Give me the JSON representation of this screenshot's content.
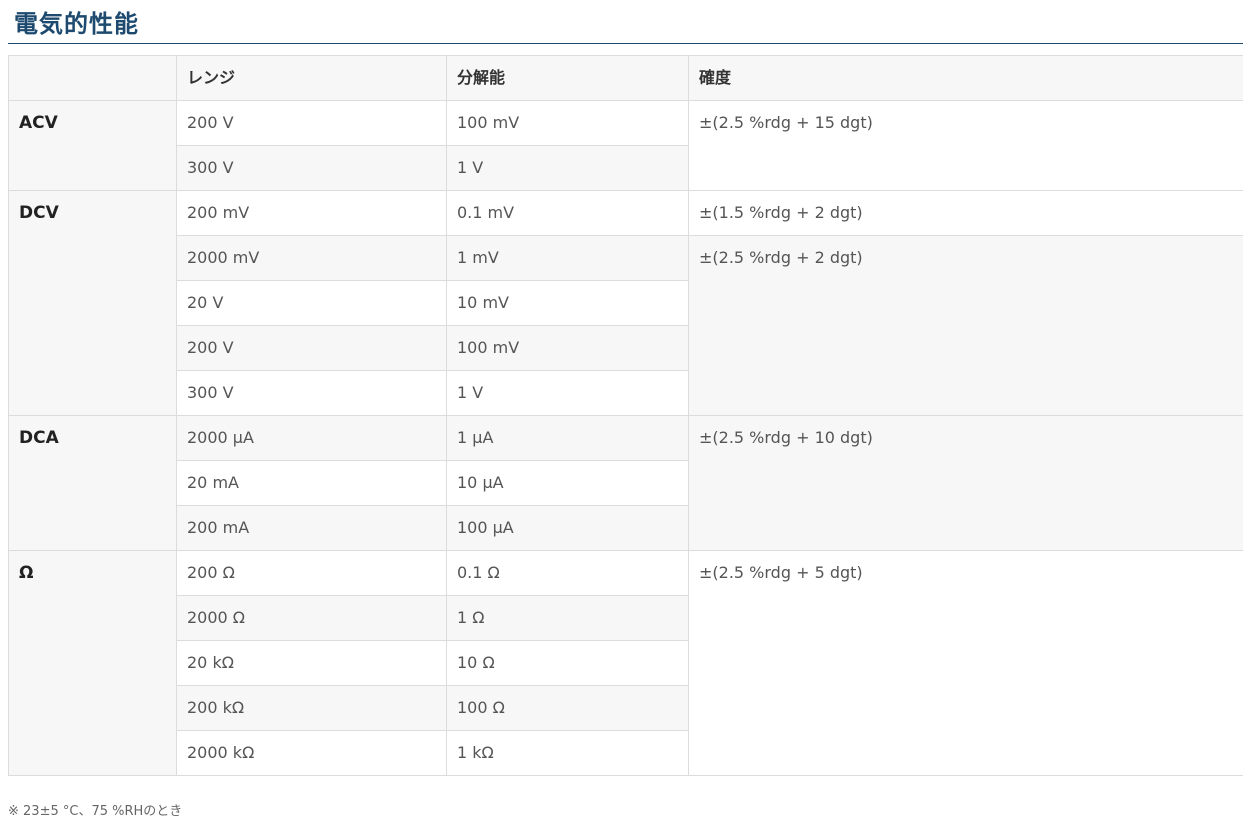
{
  "page": {
    "title": "電気的性能",
    "note": "※ 23±5 °C、75 %RHのとき"
  },
  "table": {
    "headers": [
      "",
      "レンジ",
      "分解能",
      "確度"
    ],
    "groups": [
      {
        "label": "ACV",
        "rows": [
          {
            "range": "200 V",
            "resolution": "100 mV"
          },
          {
            "range": "300 V",
            "resolution": "1 V"
          }
        ],
        "accuracy": [
          "±(2.5 %rdg + 15 dgt)"
        ]
      },
      {
        "label": "DCV",
        "rows": [
          {
            "range": "200 mV",
            "resolution": "0.1 mV"
          },
          {
            "range": "2000 mV",
            "resolution": "1 mV"
          },
          {
            "range": "20 V",
            "resolution": "10 mV"
          },
          {
            "range": "200 V",
            "resolution": "100 mV"
          },
          {
            "range": "300 V",
            "resolution": "1 V"
          }
        ],
        "accuracy": [
          "±(1.5 %rdg + 2 dgt)",
          "±(2.5 %rdg + 2 dgt)"
        ]
      },
      {
        "label": "DCA",
        "rows": [
          {
            "range": "2000 μA",
            "resolution": "1 μA"
          },
          {
            "range": "20 mA",
            "resolution": "10 μA"
          },
          {
            "range": "200 mA",
            "resolution": "100 μA"
          }
        ],
        "accuracy": [
          "±(2.5 %rdg + 10 dgt)"
        ]
      },
      {
        "label": "Ω",
        "rows": [
          {
            "range": "200 Ω",
            "resolution": "0.1 Ω"
          },
          {
            "range": "2000 Ω",
            "resolution": "1 Ω"
          },
          {
            "range": "20 kΩ",
            "resolution": "10 Ω"
          },
          {
            "range": "200 kΩ",
            "resolution": "100 Ω"
          },
          {
            "range": "2000 kΩ",
            "resolution": "1 kΩ"
          }
        ],
        "accuracy": [
          "±(2.5 %rdg + 5 dgt)"
        ]
      }
    ]
  }
}
